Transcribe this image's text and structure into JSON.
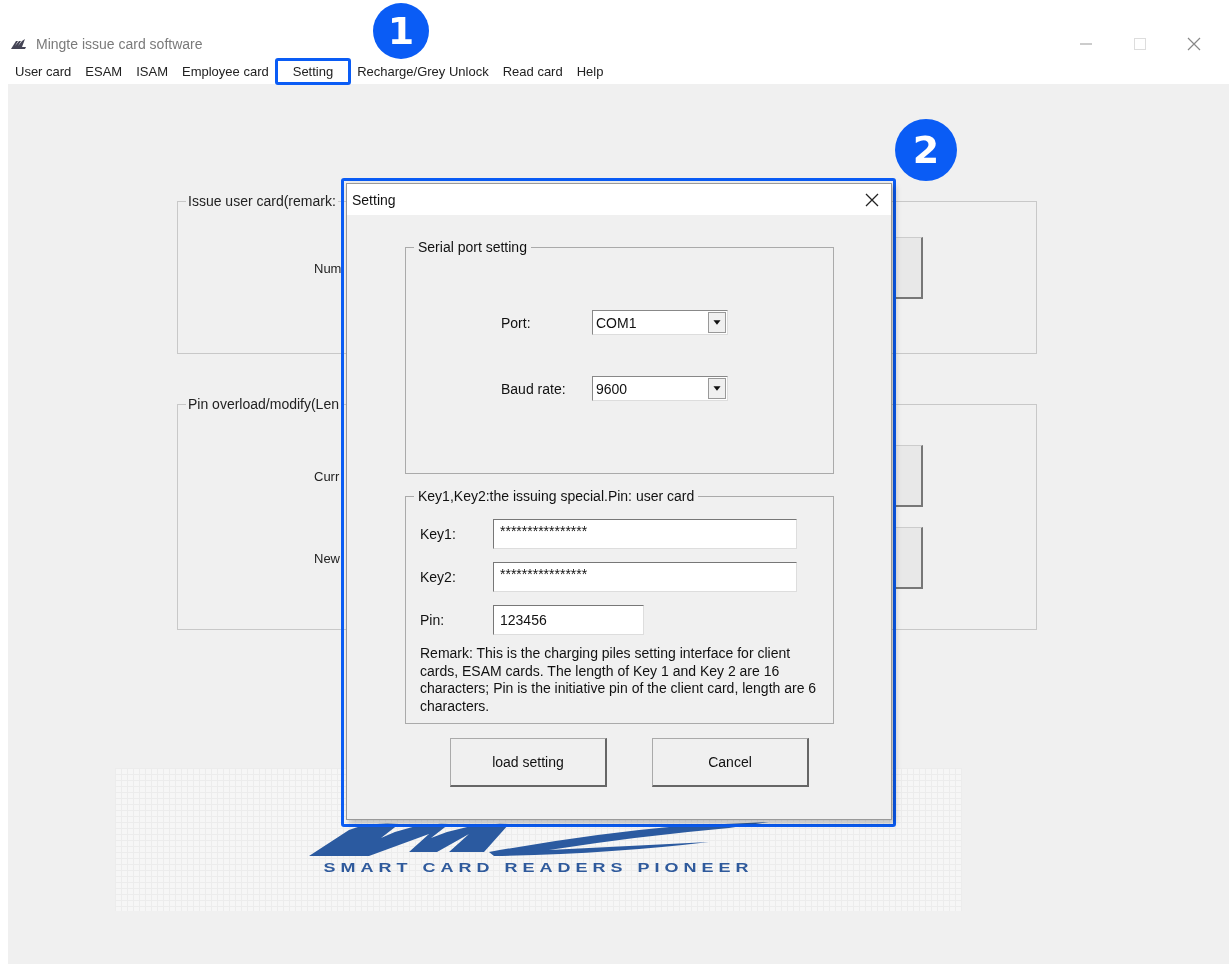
{
  "window": {
    "title": "Mingte issue card software"
  },
  "menu": [
    {
      "label": "User card",
      "selected": false
    },
    {
      "label": "ESAM",
      "selected": false
    },
    {
      "label": "ISAM",
      "selected": false
    },
    {
      "label": "Employee card",
      "selected": false
    },
    {
      "label": "Setting",
      "selected": true
    },
    {
      "label": "Recharge/Grey Unlock",
      "selected": false
    },
    {
      "label": "Read card",
      "selected": false
    },
    {
      "label": "Help",
      "selected": false
    }
  ],
  "annotations": [
    {
      "label": "1"
    },
    {
      "label": "2"
    }
  ],
  "background": {
    "groups": [
      {
        "title": "Issue user card(remark:",
        "rows": [
          {
            "label": "Num"
          }
        ]
      },
      {
        "title": "Pin overload/modify(Len",
        "rows": [
          {
            "label": "Curr"
          },
          {
            "label": "New"
          }
        ]
      }
    ],
    "logo": {
      "tagline": "SMART CARD READERS PIONEER"
    }
  },
  "dialog": {
    "title": "Setting",
    "serial": {
      "title": "Serial port setting",
      "combos": [
        {
          "label": "Port:",
          "value": "COM1"
        },
        {
          "label": "Baud rate:",
          "value": "9600"
        }
      ]
    },
    "keys": {
      "title": "Key1,Key2:the issuing special.Pin: user card",
      "fields": [
        {
          "kind": "key",
          "label": "Key1:",
          "value": "****************"
        },
        {
          "kind": "key",
          "label": "Key2:",
          "value": "****************"
        },
        {
          "kind": "pin",
          "label": "Pin:",
          "value": "123456"
        }
      ],
      "remark": "Remark: This is the charging piles setting interface for client cards, ESAM cards. The length of Key 1 and Key 2 are 16 characters; Pin is the initiative pin of the client card, length are 6 characters."
    },
    "buttons": [
      "load setting",
      "Cancel"
    ]
  }
}
